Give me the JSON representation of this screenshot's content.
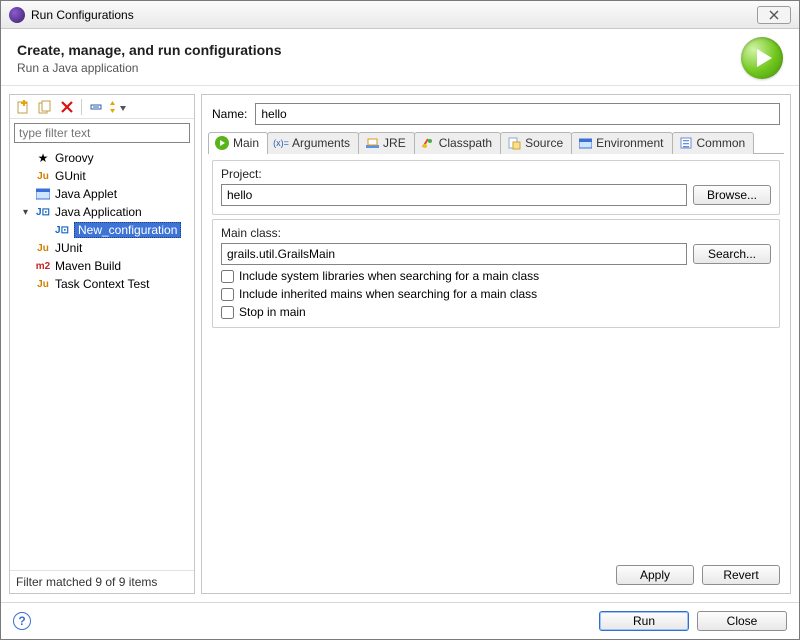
{
  "window": {
    "title": "Run Configurations"
  },
  "header": {
    "title": "Create, manage, and run configurations",
    "subtitle": "Run a Java application"
  },
  "filter": {
    "placeholder": "type filter text"
  },
  "tree": {
    "items": [
      {
        "label": "Groovy"
      },
      {
        "label": "GUnit"
      },
      {
        "label": "Java Applet"
      },
      {
        "label": "Java Application",
        "expanded": true,
        "children": [
          {
            "label": "New_configuration",
            "selected": true
          }
        ]
      },
      {
        "label": "JUnit"
      },
      {
        "label": "Maven Build"
      },
      {
        "label": "Task Context Test"
      }
    ],
    "status": "Filter matched 9 of 9 items"
  },
  "form": {
    "name_label": "Name:",
    "name_value": "hello",
    "tabs": [
      "Main",
      "Arguments",
      "JRE",
      "Classpath",
      "Source",
      "Environment",
      "Common"
    ],
    "project_label": "Project:",
    "project_value": "hello",
    "browse_label": "Browse...",
    "mainclass_label": "Main class:",
    "mainclass_value": "grails.util.GrailsMain",
    "search_label": "Search...",
    "check1": "Include system libraries when searching for a main class",
    "check2": "Include inherited mains when searching for a main class",
    "check3": "Stop in main",
    "apply": "Apply",
    "revert": "Revert"
  },
  "footer": {
    "run": "Run",
    "close": "Close"
  }
}
